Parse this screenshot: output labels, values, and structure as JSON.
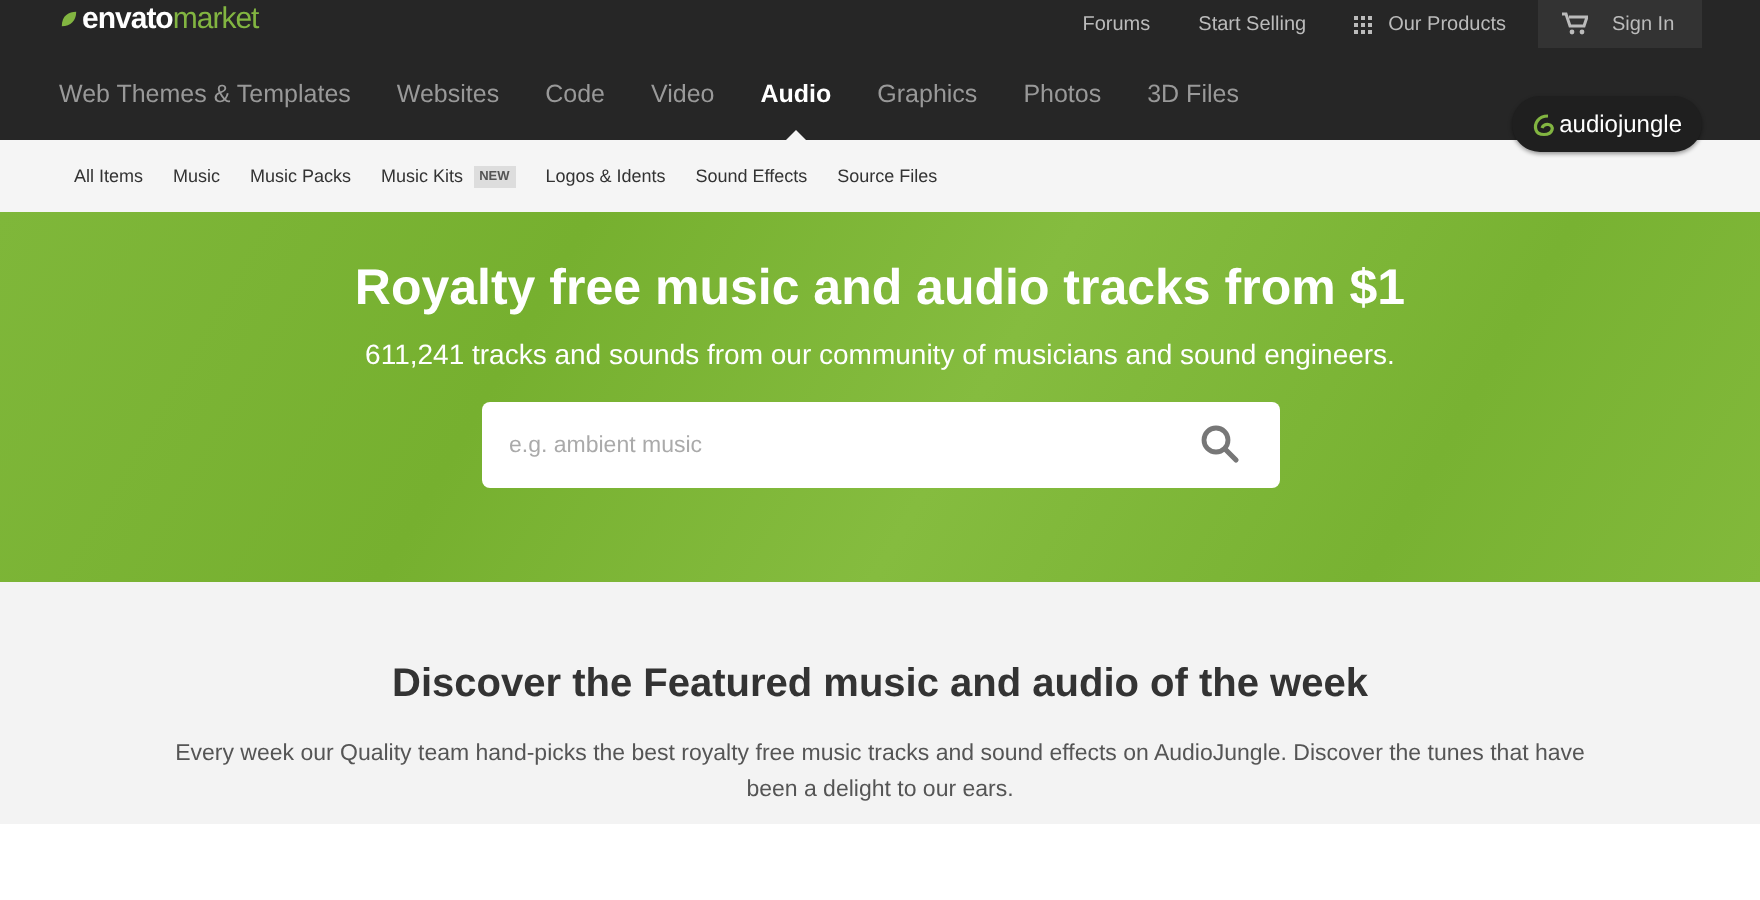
{
  "logo": "**envato**market",
  "top_links": [
    {
      "label": "Forums",
      "kind": "link"
    },
    {
      "label": "Start Selling",
      "kind": "link"
    },
    {
      "label": "Our Products",
      "kind": "grid"
    },
    {
      "label": "Sign In",
      "kind": "cart"
    }
  ],
  "categories": [
    {
      "label": "Web Themes & Templates",
      "selected": false
    },
    {
      "label": "Websites",
      "selected": false
    },
    {
      "label": "Code",
      "selected": false
    },
    {
      "label": "Video",
      "selected": false
    },
    {
      "label": "Audio",
      "selected": true
    },
    {
      "label": "Graphics",
      "selected": false
    },
    {
      "label": "Photos",
      "selected": false
    },
    {
      "label": "3D Files",
      "selected": false
    }
  ],
  "site_badge": "audiojungle",
  "subnav": [
    {
      "label": "All Items"
    },
    {
      "label": "Music"
    },
    {
      "label": "Music Packs"
    },
    {
      "label": "Music Kits",
      "badge": "NEW"
    },
    {
      "label": "Logos & Idents"
    },
    {
      "label": "Sound Effects"
    },
    {
      "label": "Source Files"
    }
  ],
  "hero": {
    "title": "Royalty free music and audio tracks from $1",
    "subtitle": "611,241 tracks and sounds from our community of musicians and sound engineers.",
    "search": {
      "placeholder": "e.g. ambient music"
    }
  },
  "featured": {
    "title": "Discover the Featured music and audio of the week",
    "text": "Every week our Quality team hand-picks the best royalty free music tracks and sound effects on AudioJungle. Discover the tunes that have been a delight to our ears."
  }
}
